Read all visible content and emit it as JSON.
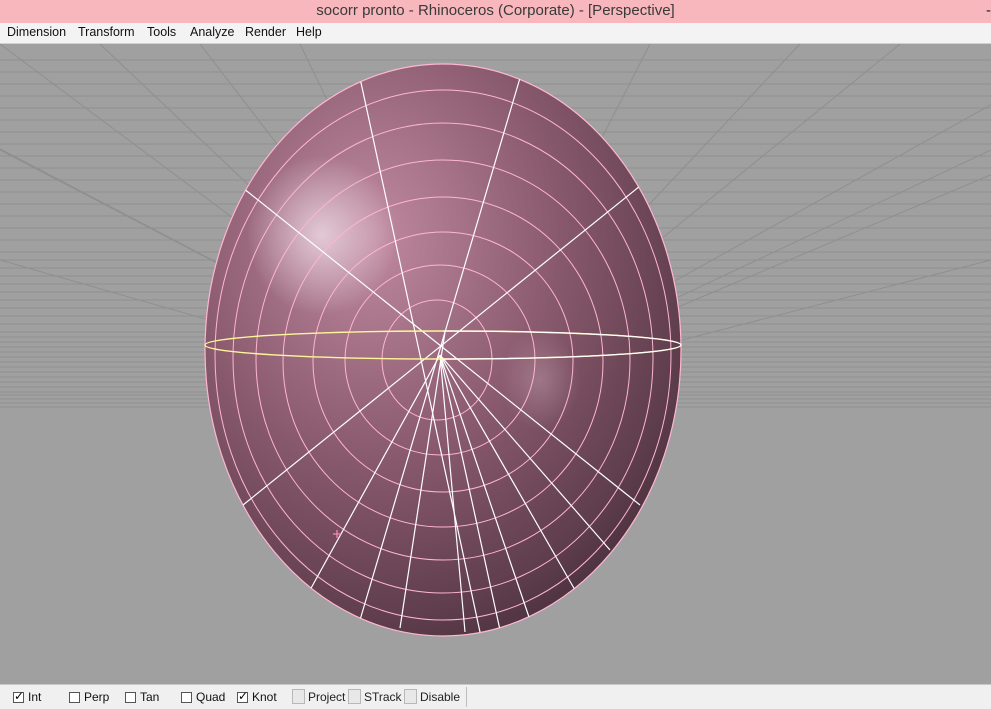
{
  "window": {
    "title": "socorr pronto - Rhinoceros (Corporate) - [Perspective]",
    "title_suffix": "-"
  },
  "menu": {
    "items": [
      "Dimension",
      "Transform",
      "Tools",
      "Analyze",
      "Render",
      "Help"
    ]
  },
  "viewport": {
    "name": "Perspective",
    "object": "ellipsoid",
    "background_color": "#a0a0a0",
    "surface_color": "#8a5a6e",
    "isocurve_color": "#ffb6d0",
    "selected_curve_color": "#ffff7a"
  },
  "statusbar": {
    "osnaps": [
      {
        "label": "Int",
        "checked": true
      },
      {
        "label": "Perp",
        "checked": false
      },
      {
        "label": "Tan",
        "checked": false
      },
      {
        "label": "Quad",
        "checked": false
      },
      {
        "label": "Knot",
        "checked": true
      }
    ],
    "toggles": [
      "Project",
      "STrack",
      "Disable"
    ]
  }
}
